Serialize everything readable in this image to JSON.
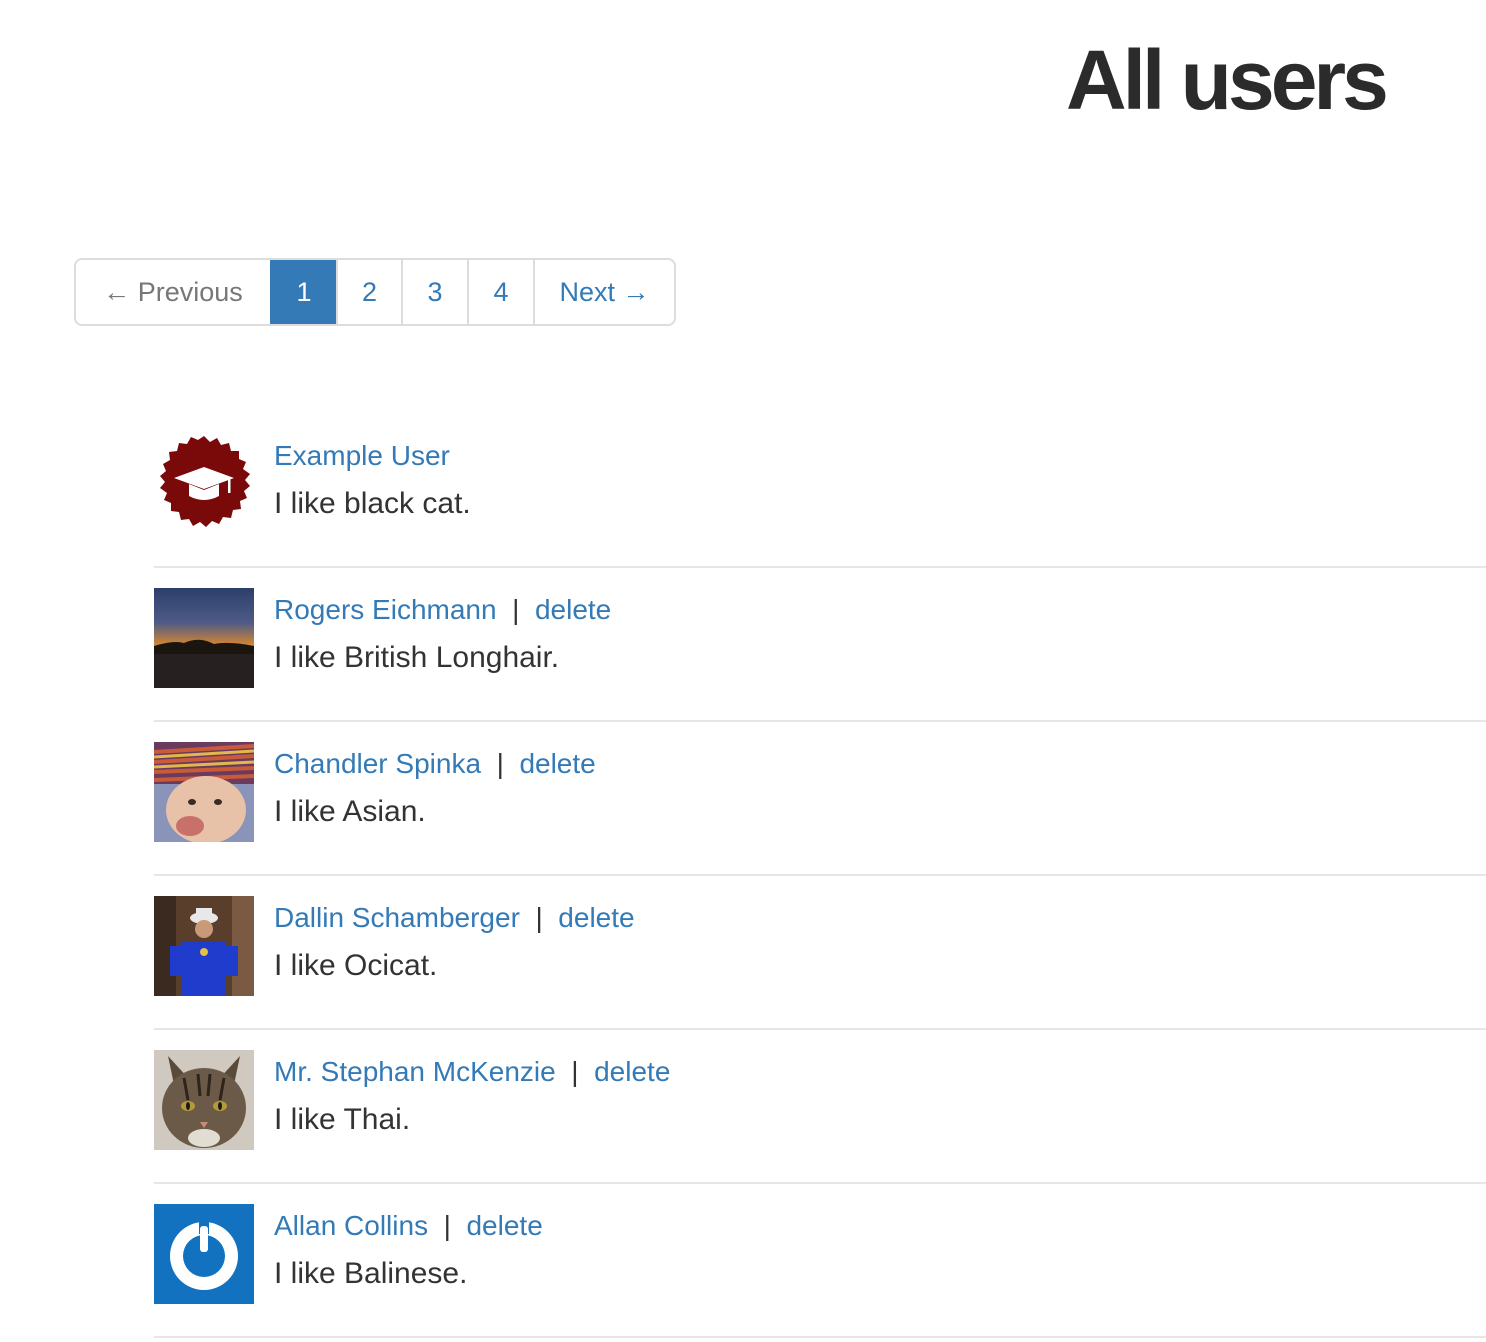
{
  "page": {
    "title": "All users"
  },
  "pagination": {
    "previous_label": "← Previous",
    "next_label": "Next →",
    "pages": [
      "1",
      "2",
      "3",
      "4"
    ],
    "current_page": "1"
  },
  "users": [
    {
      "name": "Example User",
      "bio": "I like black cat.",
      "avatar_icon": "graduation-cap-seal-icon"
    },
    {
      "name": "Rogers Eichmann",
      "separator": "|",
      "delete_label": "delete",
      "bio": "I like British Longhair.",
      "avatar_icon": "sunset-photo-icon"
    },
    {
      "name": "Chandler Spinka",
      "separator": "|",
      "delete_label": "delete",
      "bio": "I like Asian.",
      "avatar_icon": "baby-photo-icon"
    },
    {
      "name": "Dallin Schamberger",
      "separator": "|",
      "delete_label": "delete",
      "bio": "I like Ocicat.",
      "avatar_icon": "person-photo-icon"
    },
    {
      "name": "Mr. Stephan McKenzie",
      "separator": "|",
      "delete_label": "delete",
      "bio": "I like Thai.",
      "avatar_icon": "cat-photo-icon"
    },
    {
      "name": "Allan Collins",
      "separator": "|",
      "delete_label": "delete",
      "bio": "I like Balinese.",
      "avatar_icon": "power-logo-icon"
    }
  ],
  "colors": {
    "link": "#337ab7",
    "active_page_bg": "#337ab7",
    "seal": "#7a0a0a",
    "power_logo_bg": "#1272c0"
  }
}
